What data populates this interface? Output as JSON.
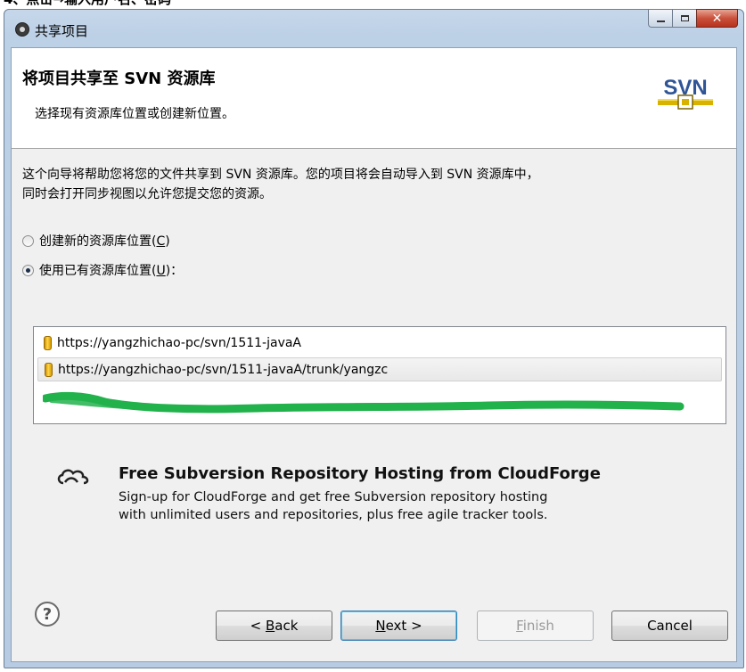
{
  "top_crop_text": "4、点击→输入用户名、密码",
  "window": {
    "title": "共享项目"
  },
  "header": {
    "title": "将项目共享至 SVN 资源库",
    "description": "选择现有资源库位置或创建新位置。",
    "logo_text": "SVN"
  },
  "intro": {
    "line1": "这个向导将帮助您将您的文件共享到 SVN 资源库。您的项目将会自动导入到 SVN 资源库中，",
    "line2": "同时会打开同步视图以允许您提交您的资源。"
  },
  "options": {
    "create_new": {
      "label": "创建新的资源库位置(",
      "mnemonic": "C",
      "suffix": ")",
      "checked": false
    },
    "use_existing": {
      "label": "使用已有资源库位置(",
      "mnemonic": "U",
      "suffix": ")：",
      "checked": true
    }
  },
  "repositories": [
    {
      "url": "https://yangzhichao-pc/svn/1511-javaA",
      "selected": false
    },
    {
      "url": "https://yangzhichao-pc/svn/1511-javaA/trunk/yangzc",
      "selected": true
    }
  ],
  "promo": {
    "title": "Free Subversion Repository Hosting from CloudForge",
    "line1": "Sign-up for CloudForge and get free Subversion repository hosting",
    "line2": "with unlimited users and repositories, plus free agile tracker tools."
  },
  "buttons": {
    "help": "?",
    "back": {
      "prefix": "< ",
      "mnemonic": "B",
      "rest": "ack"
    },
    "next": {
      "mnemonic": "N",
      "rest": "ext >"
    },
    "finish": {
      "mnemonic": "F",
      "rest": "inish",
      "enabled": false
    },
    "cancel": "Cancel"
  },
  "colors": {
    "annotation_green": "#22b24c",
    "titlebar": "#bcd0e6",
    "close_button": "#c9513b"
  }
}
